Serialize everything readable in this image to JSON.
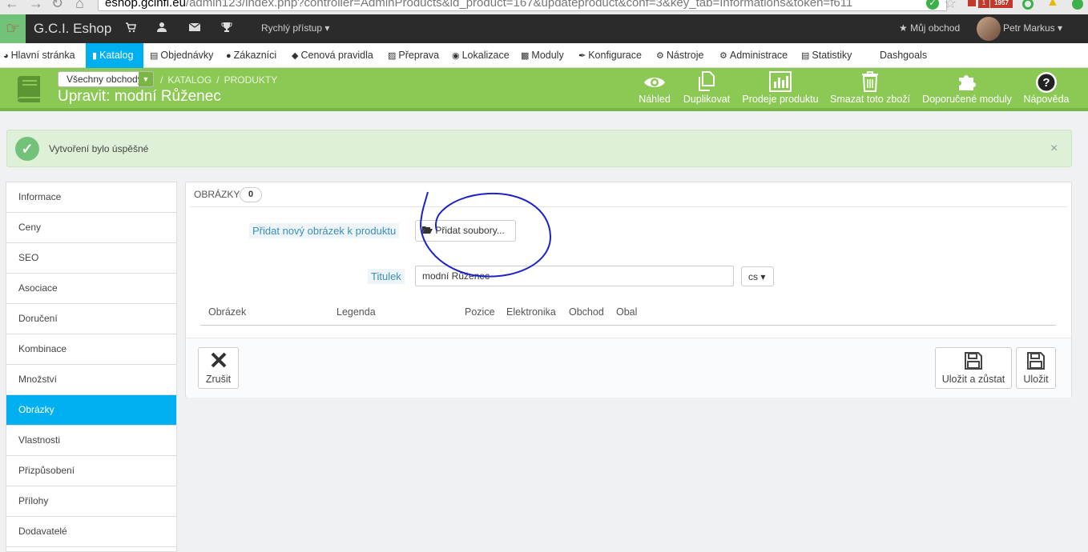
{
  "browser": {
    "url_host": "eshop.gcinfi.eu",
    "url_path": "/admin123/index.php?controller=AdminProducts&id_product=167&updateproduct&conf=3&key_tab=Informations&token=f611",
    "extension_badge": "1957"
  },
  "header": {
    "shop_name": "G.C.I. Eshop",
    "quick_access": "Rychlý přístup",
    "my_shop": "Můj obchod",
    "user_name": "Petr Markus"
  },
  "menu": [
    {
      "label": "Hlavní stránka",
      "icon": "dashboard-icon"
    },
    {
      "label": "Katalog",
      "icon": "book-icon"
    },
    {
      "label": "Objednávky",
      "icon": "credit-card-icon"
    },
    {
      "label": "Zákazníci",
      "icon": "users-icon"
    },
    {
      "label": "Cenová pravidla",
      "icon": "tag-icon"
    },
    {
      "label": "Přeprava",
      "icon": "truck-icon"
    },
    {
      "label": "Lokalizace",
      "icon": "globe-icon"
    },
    {
      "label": "Moduly",
      "icon": "puzzle-icon"
    },
    {
      "label": "Konfigurace",
      "icon": "wrench-icon"
    },
    {
      "label": "Nástroje",
      "icon": "cogs-icon"
    },
    {
      "label": "Administrace",
      "icon": "cog-icon"
    },
    {
      "label": "Statistiky",
      "icon": "bar-chart-icon"
    },
    {
      "label": "Dashgoals",
      "icon": ""
    }
  ],
  "toolbar": {
    "shop_select": "Všechny obchody",
    "breadcrumb_1": "KATALOG",
    "breadcrumb_2": "PRODUKTY",
    "page_title": "Upravit: modní Růženec",
    "buttons": [
      {
        "label": "Náhled",
        "icon": "eye-icon"
      },
      {
        "label": "Duplikovat",
        "icon": "copy-icon"
      },
      {
        "label": "Prodeje produktu",
        "icon": "bar-chart-icon"
      },
      {
        "label": "Smazat toto zboží",
        "icon": "trash-icon"
      },
      {
        "label": "Doporučené moduly",
        "icon": "puzzle-icon"
      },
      {
        "label": "Nápověda",
        "icon": "question-icon"
      }
    ]
  },
  "alert": {
    "text": "Vytvoření bylo úspěšné",
    "close": "×"
  },
  "tabs": [
    "Informace",
    "Ceny",
    "SEO",
    "Asociace",
    "Doručení",
    "Kombinace",
    "Množství",
    "Obrázky",
    "Vlastnosti",
    "Přizpůsobení",
    "Přílohy",
    "Dodavatelé"
  ],
  "active_tab": "Obrázky",
  "images_panel": {
    "heading": "OBRÁZKY",
    "count": "0",
    "add_label": "Přidat nový obrázek k produktu",
    "add_button": "Přidat soubory...",
    "title_label": "Titulek",
    "title_value": "modní Růženec",
    "language": "cs",
    "columns": [
      "Obrázek",
      "Legenda",
      "Pozice",
      "Elektronika",
      "Obchod",
      "Obal"
    ],
    "cancel_button": "Zrušit",
    "save_stay_button": "Uložit a zůstat",
    "save_button": "Uložit"
  }
}
